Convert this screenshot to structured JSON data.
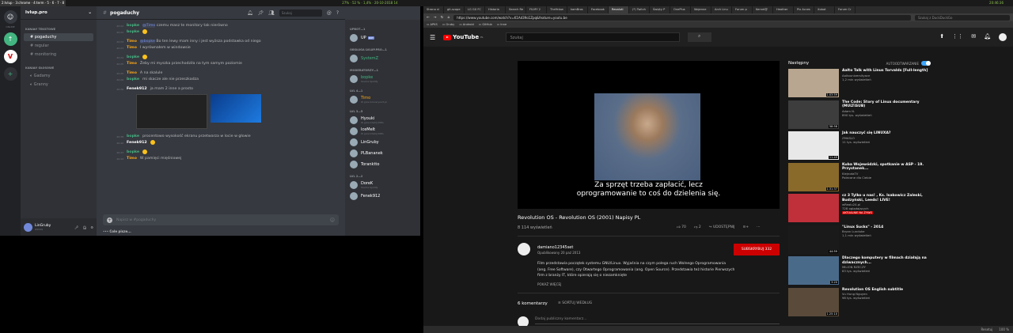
{
  "topbar": {
    "left": "2:lvlup · 3:chrome · 4:term · 5 · 6 · 7 · 8",
    "mid": "27% · 52 % · 1,4% · 20-10-2018 14",
    "right": "20:46:36"
  },
  "discord": {
    "server_name": "lvlup.pro",
    "channel_title": "pogaduchy",
    "guilds": {
      "home_label": "ONLINE"
    },
    "categories": [
      {
        "label": "KANAŁY TEKSTOWE",
        "channels": [
          "pogaduchy",
          "regular",
          "monitoring"
        ]
      },
      {
        "label": "KANAŁY GŁOSOWE",
        "channels": [
          "Gadamy",
          "Granny"
        ]
      }
    ],
    "search_placeholder": "Szukaj",
    "messages": [
      {
        "ts": "20:22",
        "author": "bopke",
        "cls": "a-bopke",
        "mention": "@Timo",
        "text": "czemu masz te monitory tak nierówno"
      },
      {
        "ts": "20:22",
        "author": "bopke",
        "cls": "a-bopke",
        "mention": "",
        "text": ""
      },
      {
        "ts": "20:23",
        "author": "Timo",
        "cls": "a-timo",
        "mention": "@bopke",
        "text": "Bo ten lewy mam inny i jest wyższa podstawka od niego"
      },
      {
        "ts": "20:23",
        "author": "Timo",
        "cls": "a-timo",
        "mention": "",
        "text": "I wyrównałem w windowsie"
      },
      {
        "ts": "20:24",
        "author": "bopke",
        "cls": "a-bopke",
        "mention": "",
        "text": ""
      },
      {
        "ts": "20:25",
        "author": "Timo",
        "cls": "a-timo",
        "mention": "",
        "text": "Żeby mi myszka przechodziła na tym samym poziomie"
      },
      {
        "ts": "20:25",
        "author": "Timo",
        "cls": "a-timo",
        "mention": "",
        "text": "A na skalule"
      },
      {
        "ts": "20:26",
        "author": "bopke",
        "cls": "a-bopke",
        "mention": "",
        "text": "mi skacze ale nie przeszkadza"
      },
      {
        "ts": "20:26",
        "author": "Fenek912",
        "cls": "a-fenek",
        "mention": "",
        "text": "ja mam 2 inne a prosto"
      }
    ],
    "messages2": [
      {
        "ts": "20:38",
        "author": "bopke",
        "cls": "a-bopke",
        "mention": "",
        "text": "procentowo wysokość ekranu przetwarza w locie w głowie"
      },
      {
        "ts": "20:40",
        "author": "Fenek912",
        "cls": "a-fenek",
        "mention": "",
        "text": ""
      },
      {
        "ts": "20:43",
        "author": "bopke",
        "cls": "a-bopke",
        "mention": "",
        "text": ""
      },
      {
        "ts": "20:44",
        "author": "Timo",
        "cls": "a-timo",
        "mention": "",
        "text": "W pamięci mięśniowej"
      }
    ],
    "composer_placeholder": "Napisz w #pogaduchy",
    "typing": "Cole pisze...",
    "user": {
      "name": "LinGruby",
      "tag": "#2549"
    },
    "member_groups": [
      {
        "label": "UPBOT—1",
        "members": [
          {
            "name": "UP",
            "sub": "",
            "bot": "BOT",
            "color": "#fff"
          }
        ]
      },
      {
        "label": "OBSŁUGA LVLUP.PRO—1",
        "members": [
          {
            "name": "SystemZ",
            "sub": "",
            "bot": "",
            "color": "#43b581"
          }
        ]
      },
      {
        "label": "MODERATORZY—1",
        "members": [
          {
            "name": "bopke",
            "sub": "Słucha Spotify",
            "bot": "",
            "color": "#43b581"
          }
        ]
      },
      {
        "label": "LVL 4—1",
        "members": [
          {
            "name": "Timo",
            "sub": "W grze Grocerysort.pl",
            "bot": "",
            "color": "#faa61a"
          }
        ]
      },
      {
        "label": "LVL 3—5",
        "members": [
          {
            "name": "Hyouki",
            "sub": "W grze IntelliJ IDEA",
            "bot": "",
            "color": "#fff"
          },
          {
            "name": "IceMelt",
            "sub": "W grze IntelliJ IDEA",
            "bot": "",
            "color": "#fff"
          },
          {
            "name": "LinGruby",
            "sub": "",
            "bot": "",
            "color": "#fff"
          },
          {
            "name": "PLBananek",
            "sub": "",
            "bot": "",
            "color": "#fff"
          },
          {
            "name": "Toranktto",
            "sub": "",
            "bot": "",
            "color": "#fff"
          }
        ]
      },
      {
        "label": "LVL 2—2",
        "members": [
          {
            "name": "DoreK",
            "sub": "Słucha Spotify",
            "bot": "",
            "color": "#fff"
          },
          {
            "name": "Fenek912",
            "sub": "",
            "bot": "",
            "color": "#fff"
          }
        ]
      }
    ]
  },
  "browser": {
    "tabs": [
      "Strona ni",
      "git-scope",
      "LG GX FC",
      "Historia",
      "Search Re",
      "FILMY 2",
      "TheYelaw",
      "kamBros",
      "Facebook",
      "Revoluti",
      "(*) Twitch",
      "Święty P",
      "OnePlus",
      "Wojenne",
      "Arch Linu",
      "Forum p",
      "Kernel@",
      "Heather",
      "Pix Acces",
      "Xobot",
      "Forum Cr"
    ],
    "active_tab": 9,
    "url": "https://www.youtube.com/watch?v=K1Ad39o1Zpq&feature=youtu.be",
    "search_placeholder": "Szukaj z DuckDuckGo",
    "bookmarks": [
      "APKS",
      "Gruby",
      "Android",
      "GitHub",
      "Inne"
    ],
    "youtube": {
      "logo": "YouTube",
      "logo_sup": "PL",
      "search_placeholder": "Szukaj",
      "subtitle_line1": "Za sprzęt trzeba zapłacić, lecz",
      "subtitle_line2": "oprogramowanie to coś do dzielenia się.",
      "title": "Revolution OS - Revolution OS (2001) Napisy PL",
      "views": "8 114 wyświetleń",
      "likes": "70",
      "dislikes": "2",
      "share": "UDOSTĘPNIJ",
      "channel": "damiano12345set",
      "published": "Opublikowany 20 paź 2013",
      "subscribe": "SUBSKRYBUJ 332",
      "description": "Film przedstawia początek systemu GNU/Linux. Wyjaśnia na czym polega ruch Wolnego Oprogramowania (ang. Free Software), czy Otwartego Oprogramowania (ang. Open Source). Przedstawia też historie Pierwszych firm z branży IT, które opierają się o niezamknięte",
      "show_more": "POKAŻ WIĘCEJ",
      "comments_count": "6 komentarzy",
      "sort": "SORTUJ WEDŁUG",
      "comment_placeholder": "Dodaj publiczny komentarz...",
      "up_next": "Następny",
      "autoplay": "AUTOODTWARZANIE",
      "recommended": [
        {
          "title": "Aalto Talk with Linus Torvalds [Full-length]",
          "channel": "Aaltouniversityace",
          "meta": "1,2 mln wyświetleń",
          "dur": "1:03:59",
          "bg": "#b9a690",
          "live": ""
        },
        {
          "title": "The Code: Story of Linux documentary (MULTiSUB)",
          "channel": "Adam N.",
          "meta": "890 tys. wyświetleń",
          "dur": "58:58",
          "bg": "#3d3d3d",
          "live": ""
        },
        {
          "title": "Jak nauczyć się LINUXA?",
          "channel": "ZMASLO",
          "meta": "11 tys. wyświetleń",
          "dur": "11:49",
          "bg": "#e8e8e8",
          "live": ""
        },
        {
          "title": "Kuba Wojewódzki, spotkanie w ASP - 19. Przystanek...",
          "channel": "KlejnotaTV",
          "meta": "Polecane dla Ciebie",
          "dur": "1:31:37",
          "bg": "#8a6a2a",
          "live": ""
        },
        {
          "title": "cz 3 Tylko u nas! , Ks. Isakowicz Zaleski, Budzyński, Leeds! LIVE!",
          "channel": "wRealu24.pl",
          "meta": "728 oglądających",
          "dur": "",
          "bg": "#c0303a",
          "live": "AKTUALNIE NA ŻYWO"
        },
        {
          "title": "\"Linux Sucks\" - 2014",
          "channel": "Bryan Lunduke",
          "meta": "1,1 mln wyświetleń",
          "dur": "44:59",
          "bg": "#1a1a1a",
          "live": ""
        },
        {
          "title": "Dlaczego komputery w filmach działają na dziwacznych...",
          "channel": "MILION RZECZY",
          "meta": "83 tys. wyświetleń",
          "dur": "3:20",
          "bg": "#4a6a8a",
          "live": ""
        },
        {
          "title": "Revolution OS English subtitle",
          "channel": "Vu Hung Nguyen",
          "meta": "98 tys. wyświetleń",
          "dur": "1:25:10",
          "bg": "#5a4a3a",
          "live": ""
        }
      ]
    },
    "status": {
      "reset": "Resetuj",
      "zoom": "100 %"
    }
  }
}
